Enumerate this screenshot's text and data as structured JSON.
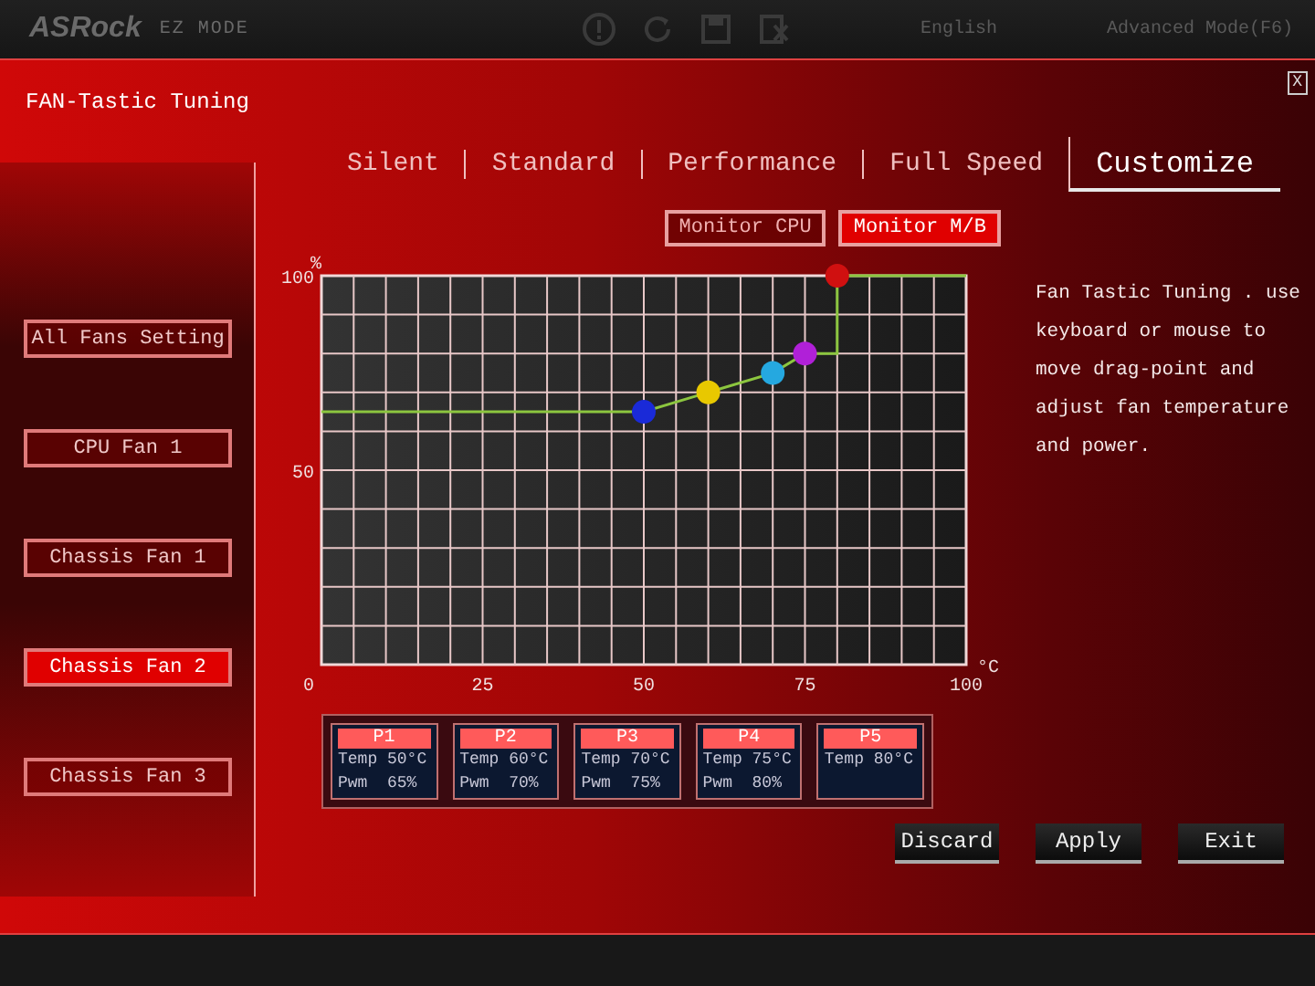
{
  "background_header": {
    "logo": "ASRock",
    "mode": "EZ MODE",
    "language": "English",
    "advanced": "Advanced Mode(F6)"
  },
  "dialog": {
    "title": "FAN-Tastic Tuning",
    "close": "X"
  },
  "fans": [
    {
      "label": "All Fans Setting",
      "selected": false
    },
    {
      "label": "CPU Fan 1",
      "selected": false
    },
    {
      "label": "Chassis Fan 1",
      "selected": false
    },
    {
      "label": "Chassis Fan 2",
      "selected": true
    },
    {
      "label": "Chassis Fan 3",
      "selected": false
    }
  ],
  "modes": [
    {
      "label": "Silent",
      "selected": false
    },
    {
      "label": "Standard",
      "selected": false
    },
    {
      "label": "Performance",
      "selected": false
    },
    {
      "label": "Full Speed",
      "selected": false
    },
    {
      "label": "Customize",
      "selected": true
    }
  ],
  "monitors": [
    {
      "label": "Monitor CPU",
      "selected": false
    },
    {
      "label": "Monitor M/B",
      "selected": true
    }
  ],
  "chart": {
    "handles": [
      {
        "color": "#1a2ad8"
      },
      {
        "color": "#e8c800"
      },
      {
        "color": "#25a8e0"
      },
      {
        "color": "#b020d8"
      },
      {
        "color": "#d01010"
      }
    ],
    "chart_data": {
      "type": "line",
      "xlabel": "°C",
      "ylabel": "%",
      "x": [
        0,
        50,
        60,
        70,
        75,
        80,
        80,
        100
      ],
      "series": [
        {
          "color": "#8cc63f",
          "values": [
            65,
            65,
            70,
            75,
            80,
            80,
            100,
            100
          ]
        }
      ],
      "xlim": [
        0,
        100
      ],
      "ylim": [
        0,
        100
      ],
      "xticks": [
        0,
        25,
        50,
        75,
        100
      ],
      "yticks": [
        50,
        100
      ],
      "grid": true
    }
  },
  "help": "Fan Tastic Tuning . use keyboard or mouse to move drag-point and adjust fan temperature and power.",
  "points": [
    {
      "name": "P1",
      "temp": "Temp 50°C",
      "pwm": "Pwm  65%"
    },
    {
      "name": "P2",
      "temp": "Temp 60°C",
      "pwm": "Pwm  70%"
    },
    {
      "name": "P3",
      "temp": "Temp 70°C",
      "pwm": "Pwm  75%"
    },
    {
      "name": "P4",
      "temp": "Temp 75°C",
      "pwm": "Pwm  80%"
    },
    {
      "name": "P5",
      "temp": "Temp 80°C"
    }
  ],
  "buttons": [
    "Discard",
    "Apply",
    "Exit"
  ]
}
